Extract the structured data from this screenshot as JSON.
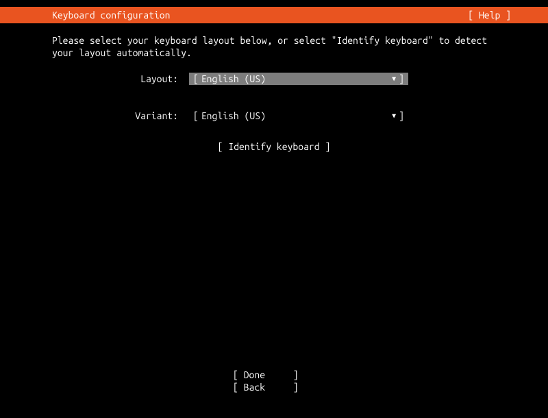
{
  "header": {
    "title": "Keyboard configuration",
    "help": "[ Help ]"
  },
  "instruction": "Please select your keyboard layout below, or select \"Identify keyboard\" to detect your layout automatically.",
  "form": {
    "layout_label": "Layout:",
    "layout_value": "English (US)",
    "variant_label": "Variant:",
    "variant_value": "English (US)"
  },
  "buttons": {
    "identify": "[ Identify keyboard ]",
    "done": "Done",
    "back": "Back"
  }
}
